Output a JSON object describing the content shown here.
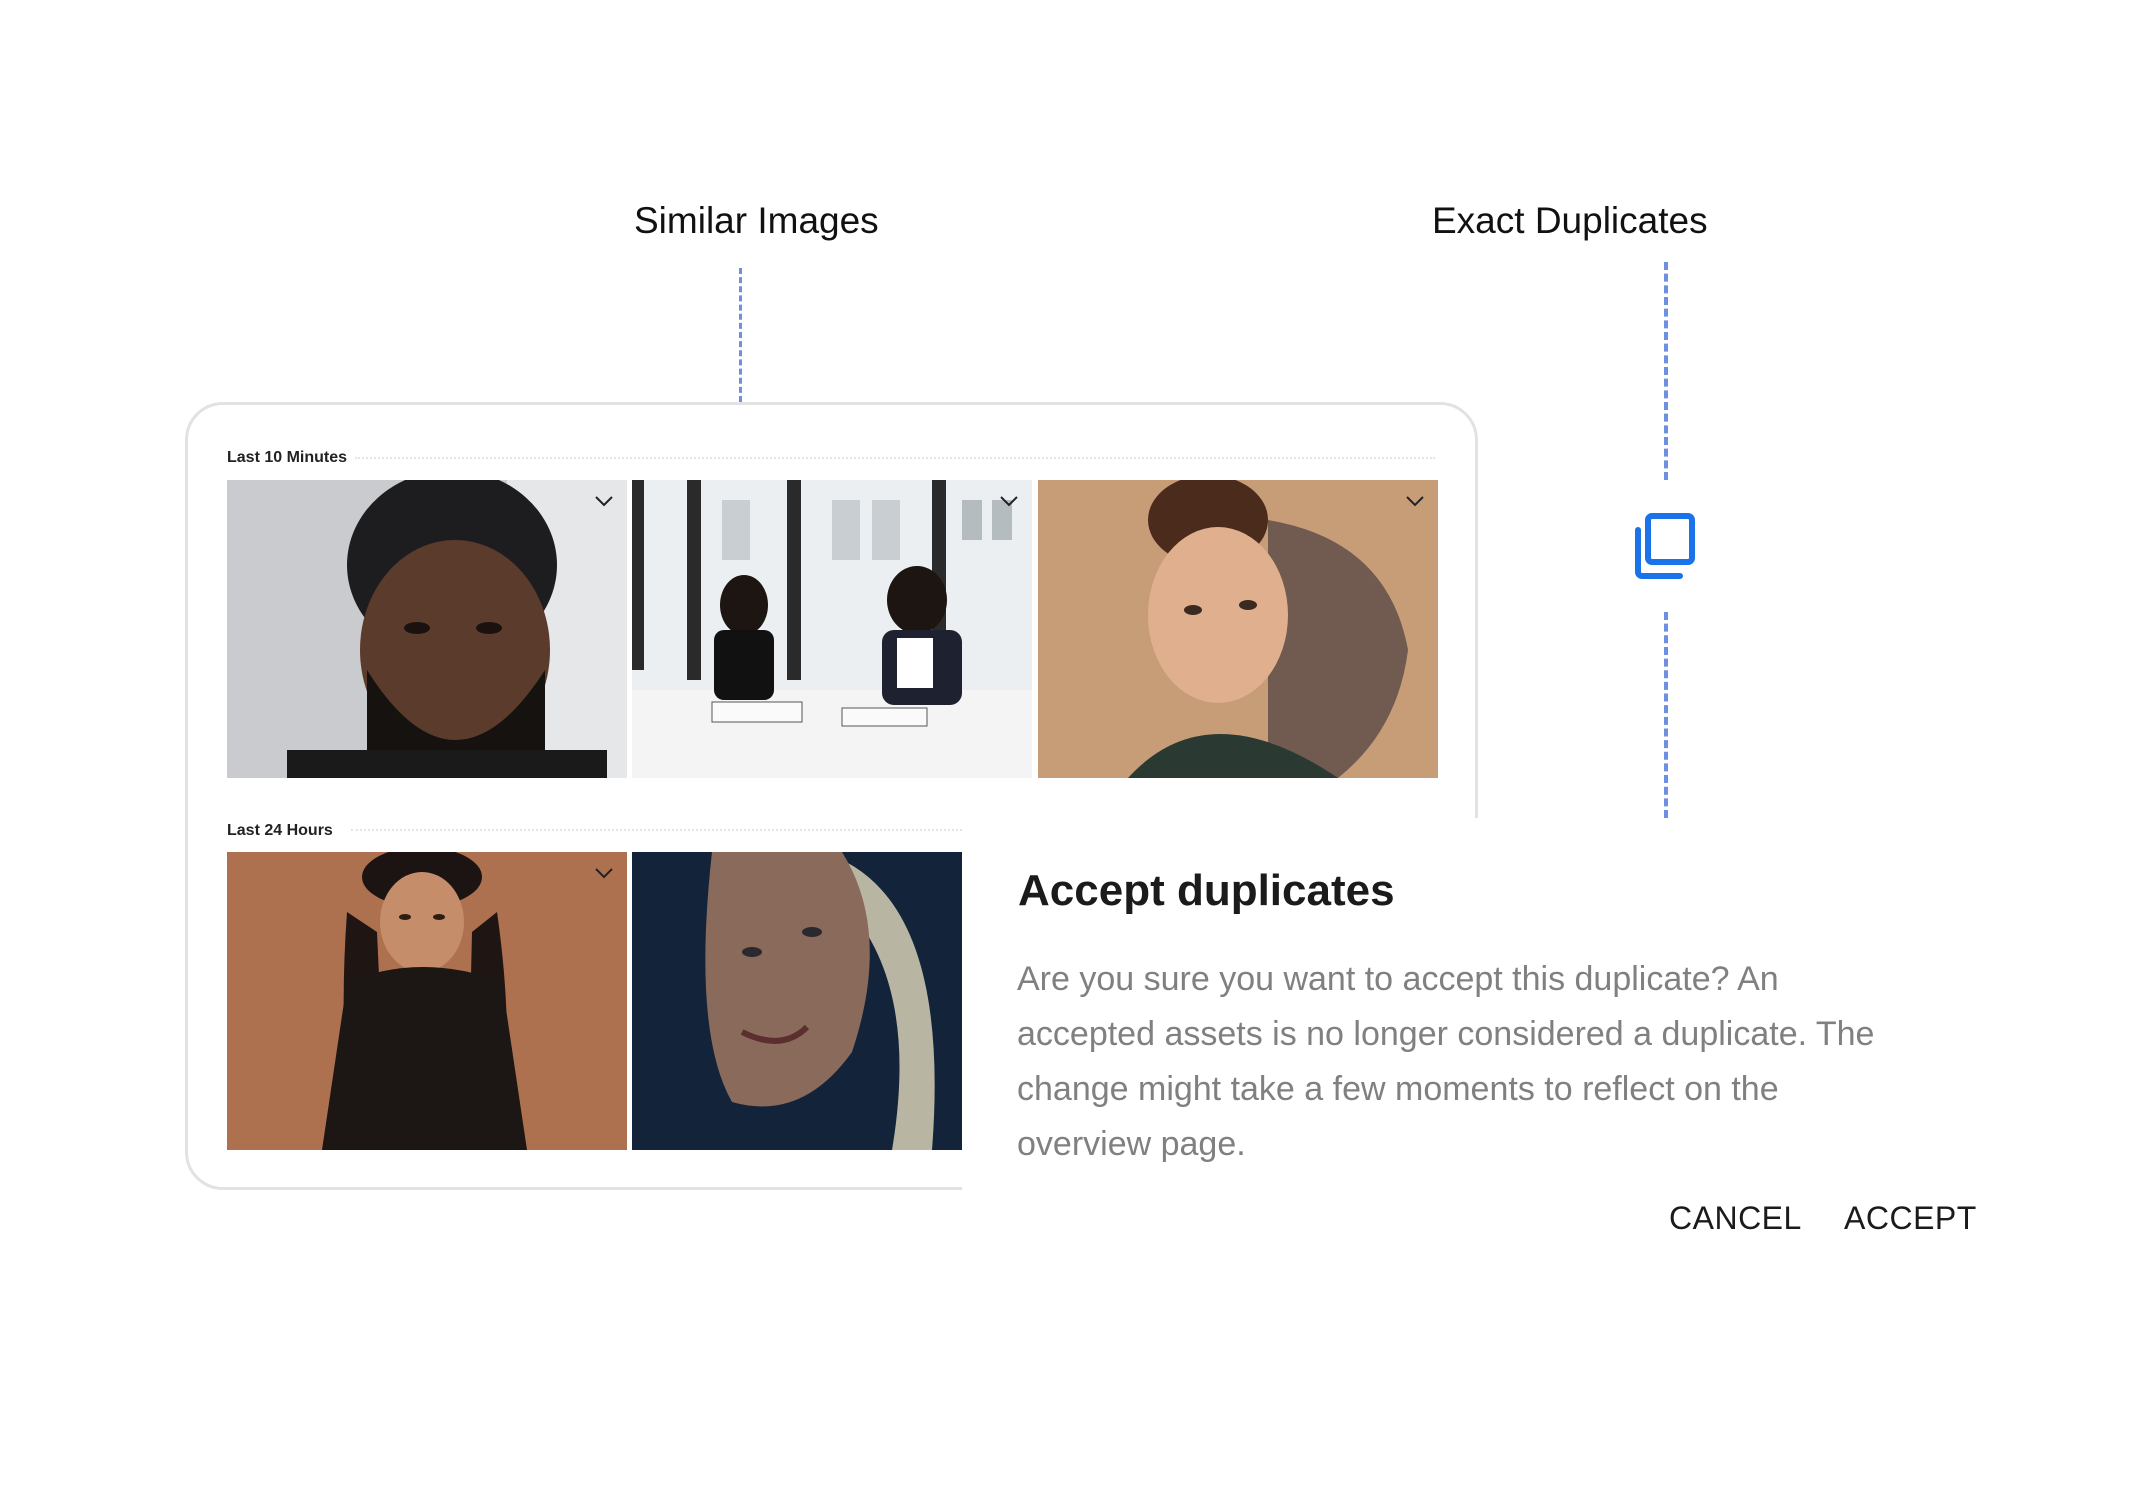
{
  "callouts": {
    "similar_images": "Similar Images",
    "exact_duplicates": "Exact Duplicates"
  },
  "panel": {
    "sections": [
      {
        "title": "Last 10 Minutes",
        "thumbnails": [
          {
            "subject": "bearded man in black beanie",
            "chevron_icon": "chevron-down-icon"
          },
          {
            "subject": "two women meeting at office table",
            "chevron_icon": "chevron-down-icon"
          },
          {
            "subject": "young woman portrait in sunlight",
            "chevron_icon": "chevron-down-icon"
          }
        ]
      },
      {
        "title": "Last 24 Hours",
        "thumbnails": [
          {
            "subject": "smiling woman with hands on cheeks",
            "chevron_icon": "chevron-down-icon"
          },
          {
            "subject": "blonde woman close-up in blue light"
          }
        ]
      }
    ]
  },
  "icons": {
    "duplicate": "copy-duplicate-icon"
  },
  "colors": {
    "accent_blue": "#1a73e8",
    "dash_blue": "#6f8fe0",
    "body_text_gray": "#808080"
  },
  "dialog": {
    "title": "Accept duplicates",
    "body": "Are you sure you want to accept this duplicate? An accepted  assets is no longer considered a duplicate. The change might take a few moments to reflect on the overview page.",
    "cancel_label": "CANCEL",
    "accept_label": "ACCEPT"
  }
}
